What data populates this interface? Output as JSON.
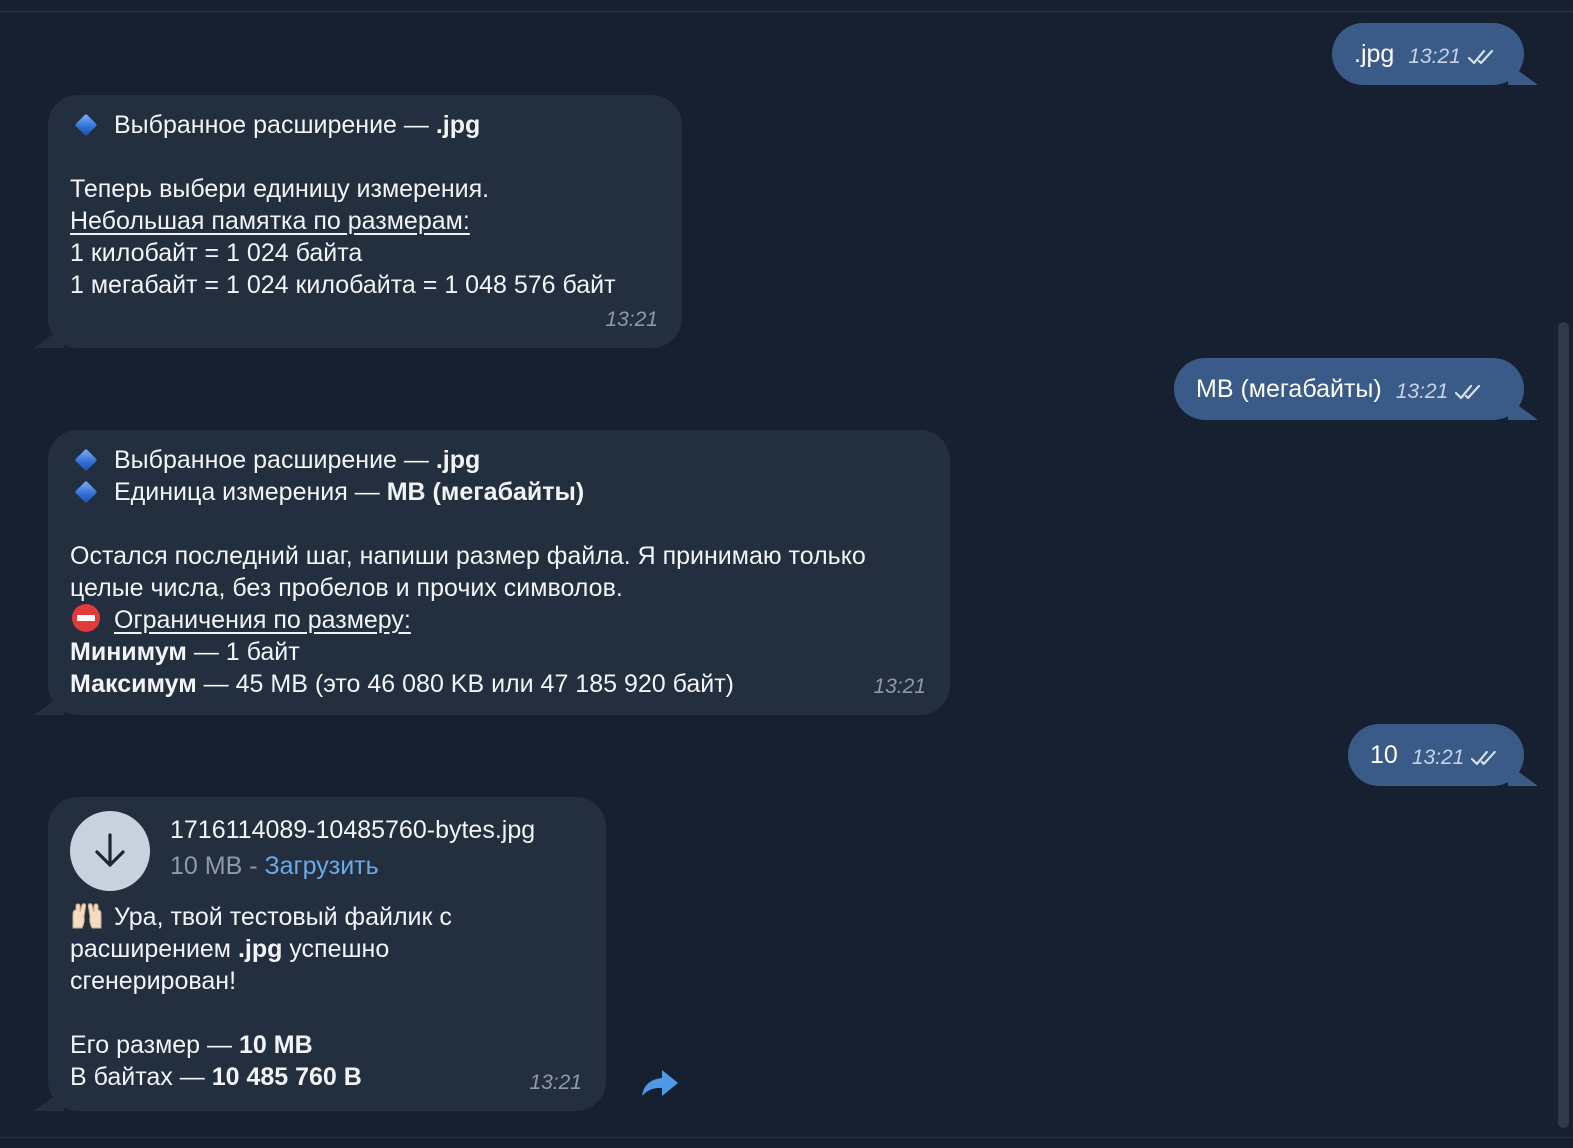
{
  "messages": {
    "m1": {
      "text": ".jpg",
      "time": "13:21"
    },
    "m2": {
      "line1_prefix": "Выбранное расширение — ",
      "line1_bold": ".jpg",
      "line2": "Теперь выбери единицу измерения.",
      "line3_underlined": "Небольшая памятка по размерам:",
      "line4": "1 килобайт = 1 024 байта",
      "line5": "1 мегабайт = 1 024 килобайта = 1 048 576 байт",
      "time": "13:21"
    },
    "m3": {
      "text": "MB (мегабайты)",
      "time": "13:21"
    },
    "m4": {
      "line1_prefix": "Выбранное расширение — ",
      "line1_bold": ".jpg",
      "line2_prefix": "Единица измерения — ",
      "line2_bold": "MB (мегабайты)",
      "line3": "Остался последний шаг, напиши размер файла. Я принимаю только",
      "line4": "целые числа, без пробелов и прочих символов.",
      "line5_underlined": "Ограничения по размеру:",
      "line6_bold": "Минимум",
      "line6_rest": " — 1 байт",
      "line7_bold": "Максимум",
      "line7_rest": " — 45 MB (это 46 080 KB или 47 185 920 байт)",
      "time": "13:21"
    },
    "m5": {
      "text": "10",
      "time": "13:21"
    },
    "m6": {
      "file_name": "1716114089-10485760-bytes.jpg",
      "file_size": "10 MB",
      "file_sep": " - ",
      "download_label": "Загрузить",
      "line1": "Ура, твой тестовый файлик с",
      "line2_prefix": "расширением ",
      "line2_bold": ".jpg",
      "line2_rest": " успешно",
      "line3": "сгенерирован!",
      "line4_prefix": "Его размер — ",
      "line4_bold": "10 MB",
      "line5_prefix": "В байтах — ",
      "line5_bold": "10 485 760 B",
      "time": "13:21"
    }
  },
  "colors": {
    "background": "#172030",
    "incoming_bubble": "#232e3f",
    "outgoing_bubble": "#3a5a88",
    "link": "#6aa9ec",
    "time_incoming": "#8e9aab"
  },
  "icons": {
    "read_receipt": "double-check-icon",
    "bullet": "blue-diamond-icon",
    "no_entry": "no-entry-icon",
    "raised_hands": "raised-hands-icon",
    "download": "download-arrow-icon",
    "share": "share-icon"
  }
}
